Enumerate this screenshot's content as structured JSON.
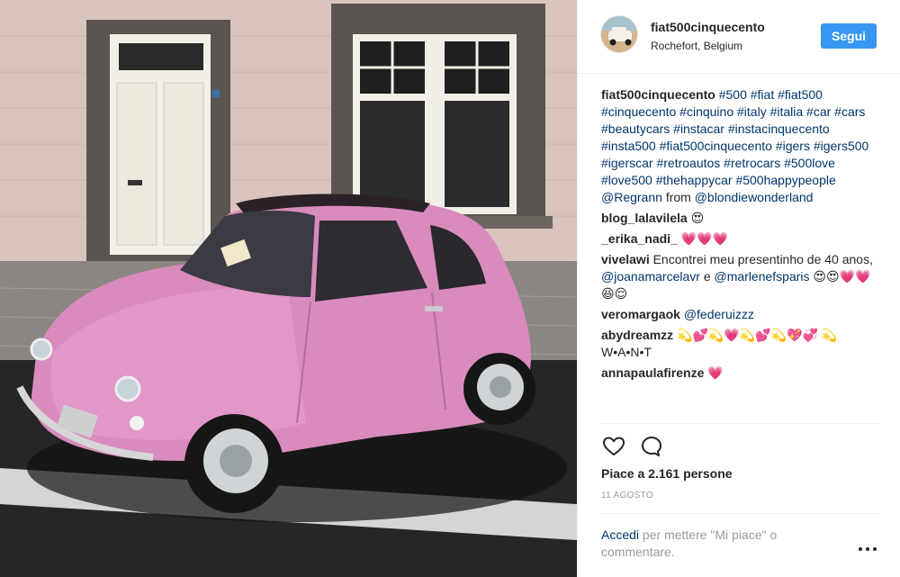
{
  "post": {
    "username": "fiat500cinquecento",
    "location": "Rochefort, Belgium",
    "follow_label": "Segui",
    "avatar_icon": "car-avatar-icon"
  },
  "caption": {
    "user": "fiat500cinquecento",
    "hashtags_line": "#500 #fiat #fiat500 #cinquecento #cinquino #italy #italia #car #cars #beautycars #instacar #instacinquecento #insta500 #fiat500cinquecento #igers #igers500 #igerscar #retroautos #retrocars #500love #love500 #thehappycar #500happypeople",
    "mention": "@Regrann",
    "from_word": "from",
    "mention2": "@blondiewonderland"
  },
  "comments": [
    {
      "user": "blog_lalavilela",
      "text": "😍"
    },
    {
      "user": "_erika_nadi_",
      "text": "💗💗💗"
    },
    {
      "user": "vivelawi",
      "text": "Encontrei meu presentinho de 40 anos,",
      "mention": "@joanamarcelavr",
      "joiner": "e",
      "mention2": "@marlenefsparis",
      "tail": "😍😍💗💗😆😌"
    },
    {
      "user": "veromargaok",
      "text": "",
      "mention": "@federuizzz"
    },
    {
      "user": "abydreamzz",
      "text": "💫💕💫💗💫💕💫💖💞 💫 W•A•N•T"
    },
    {
      "user": "annapaulafirenze",
      "text": "💗"
    }
  ],
  "actions": {
    "like_icon": "heart-icon",
    "comment_icon": "comment-icon",
    "likes_text": "Piace a 2.161 persone",
    "date": "11 AGOSTO"
  },
  "footer": {
    "login_link": "Accedi",
    "login_text": "per mettere \"Mi piace\" o commentare.",
    "more_icon": "more-options-icon"
  },
  "colors": {
    "follow_button": "#3897f0",
    "link": "#003569",
    "muted": "#999999",
    "car": "#d98bbd"
  }
}
